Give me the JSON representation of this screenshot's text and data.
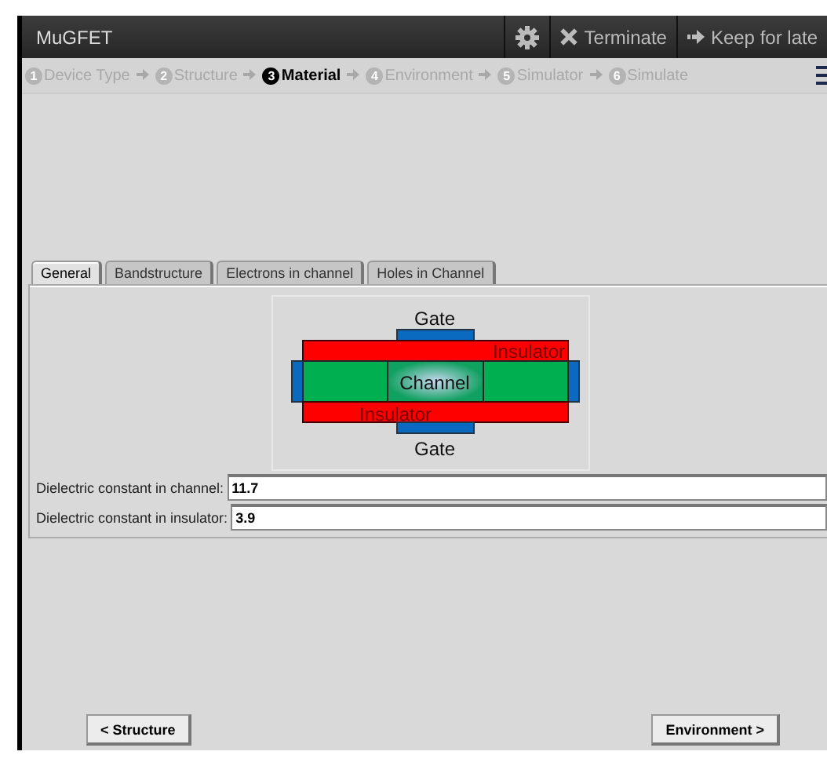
{
  "window": {
    "title": "MuGFET",
    "actions": [
      {
        "kind": "settings"
      },
      {
        "kind": "terminate",
        "label": "Terminate"
      },
      {
        "kind": "later",
        "label": "Keep for late"
      }
    ]
  },
  "steps": [
    {
      "number": "1",
      "label": "Device Type",
      "selected": false
    },
    {
      "number": "2",
      "label": "Structure",
      "selected": false
    },
    {
      "number": "3",
      "label": "Material",
      "selected": true
    },
    {
      "number": "4",
      "label": "Environment",
      "selected": false
    },
    {
      "number": "5",
      "label": "Simulator",
      "selected": false
    },
    {
      "number": "6",
      "label": "Simulate",
      "selected": false
    }
  ],
  "tabs": [
    {
      "label": "General",
      "selected": true
    },
    {
      "label": "Bandstructure",
      "selected": false
    },
    {
      "label": "Electrons in channel",
      "selected": false
    },
    {
      "label": "Holes in Channel",
      "selected": false
    }
  ],
  "diagram": {
    "gate_top": "Gate",
    "insulator_top": "Insulator",
    "channel": "Channel",
    "insulator_bottom": "Insulator",
    "gate_bottom": "Gate"
  },
  "fields": [
    {
      "label": "Dielectric constant in channel:",
      "value": "11.7"
    },
    {
      "label": "Dielectric constant in insulator:",
      "value": "3.9"
    }
  ],
  "buttons": {
    "back": "< Structure",
    "next": "Environment >"
  }
}
